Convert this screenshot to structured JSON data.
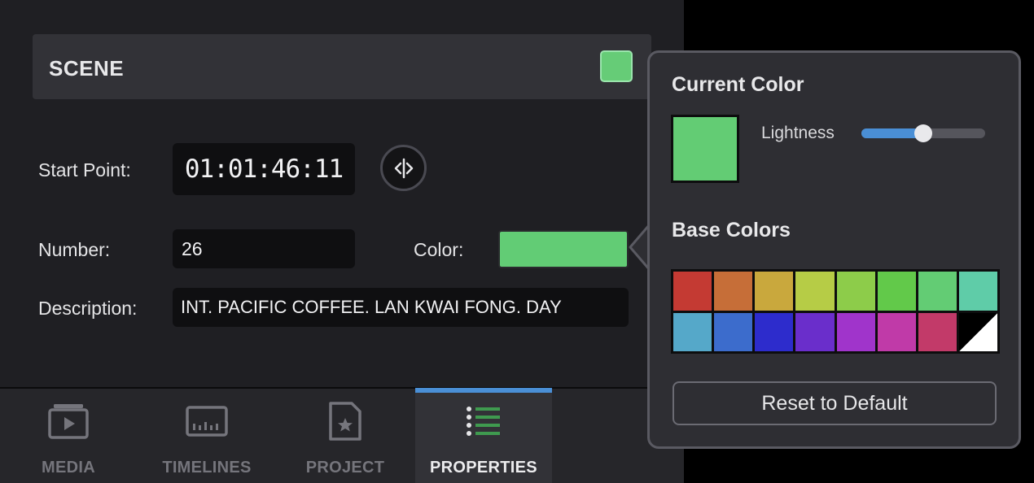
{
  "scene": {
    "title": "SCENE",
    "color": "#66cc77"
  },
  "fields": {
    "start_point_label": "Start Point:",
    "start_point_value": "01:01:46:11",
    "number_label": "Number:",
    "number_value": "26",
    "color_label": "Color:",
    "color_value": "#62cc75",
    "description_label": "Description:",
    "description_value": "INT. PACIFIC COFFEE. LAN KWAI FONG. DAY"
  },
  "tabs": [
    {
      "label": "MEDIA",
      "icon": "media-icon",
      "active": false
    },
    {
      "label": "TIMELINES",
      "icon": "timelines-icon",
      "active": false
    },
    {
      "label": "PROJECT",
      "icon": "project-icon",
      "active": false
    },
    {
      "label": "PROPERTIES",
      "icon": "properties-icon",
      "active": true
    }
  ],
  "popover": {
    "current_color_title": "Current Color",
    "current_color": "#63cc74",
    "lightness_label": "Lightness",
    "lightness_value": 0.5,
    "base_colors_title": "Base Colors",
    "base_colors": [
      "#c43a33",
      "#c66e38",
      "#c9a83d",
      "#b6cc46",
      "#8dcc4a",
      "#62c94a",
      "#63cc74",
      "#5fcca8",
      "#55a8c9",
      "#3c6ccc",
      "#2d2ccc",
      "#6a2ecb",
      "#a034cb",
      "#c03aa8",
      "#c23a69",
      "black-white"
    ],
    "reset_label": "Reset to Default"
  },
  "colors": {
    "accent": "#4a8fd6",
    "panel_bg": "#1f1f23"
  }
}
